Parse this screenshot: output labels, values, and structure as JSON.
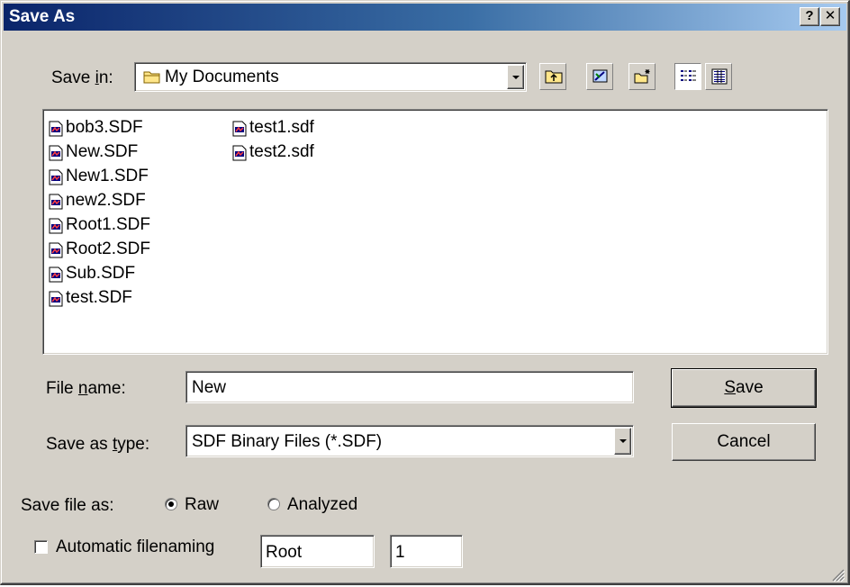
{
  "window": {
    "title": "Save As",
    "help_glyph": "?",
    "close_glyph": "✕"
  },
  "save_in": {
    "label_pre": "Save ",
    "label_key": "i",
    "label_post": "n:",
    "value": "My Documents"
  },
  "toolbar": {
    "icons": [
      "up-folder-icon",
      "desktop-icon",
      "new-folder-icon",
      "list-view-icon",
      "details-view-icon"
    ]
  },
  "files": {
    "column1": [
      "bob3.SDF",
      "New.SDF",
      "New1.SDF",
      "new2.SDF",
      "Root1.SDF",
      "Root2.SDF",
      "Sub.SDF",
      "test.SDF"
    ],
    "column2": [
      "test1.sdf",
      "test2.sdf"
    ]
  },
  "file_name": {
    "label_pre": "File ",
    "label_key": "n",
    "label_post": "ame:",
    "value": "New"
  },
  "save_as_type": {
    "label_pre": "Save as ",
    "label_key": "t",
    "label_post": "ype:",
    "value": "SDF Binary Files (*.SDF)"
  },
  "buttons": {
    "save_key": "S",
    "save_rest": "ave",
    "cancel": "Cancel"
  },
  "save_file_as": {
    "label": "Save file as:",
    "options": [
      "Raw",
      "Analyzed"
    ],
    "selected": "Raw"
  },
  "auto_naming": {
    "label": "Automatic filenaming",
    "checked": false,
    "prefix": "Root",
    "start": "1"
  },
  "colors": {
    "title_start": "#0a246a",
    "title_end": "#a6caf0",
    "face": "#d4d0c8"
  }
}
